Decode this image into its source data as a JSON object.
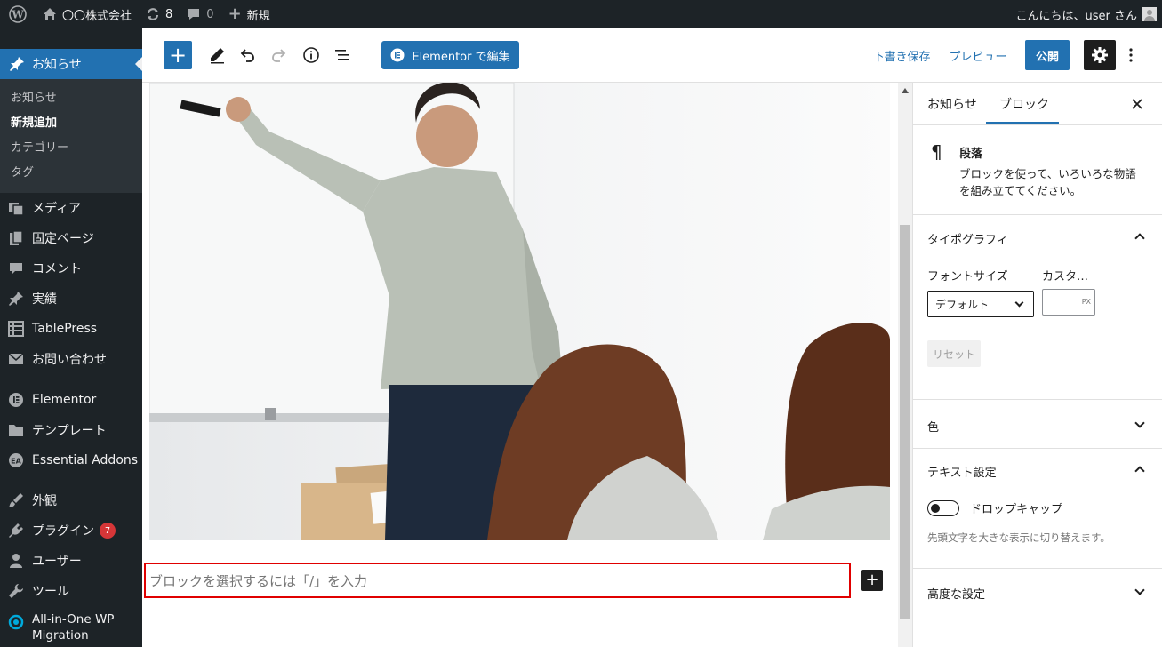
{
  "adminbar": {
    "site_name": "〇〇株式会社",
    "updates_count": "8",
    "comments_count": "0",
    "new_label": "新規",
    "greeting": "こんにちは、user さん"
  },
  "sidebar": {
    "current": "お知らせ",
    "submenu": [
      "お知らせ",
      "新規追加",
      "カテゴリー",
      "タグ"
    ],
    "items": [
      {
        "label": "メディア",
        "icon": "media-icon"
      },
      {
        "label": "固定ページ",
        "icon": "page-icon"
      },
      {
        "label": "コメント",
        "icon": "comment-icon"
      },
      {
        "label": "実績",
        "icon": "pin-icon"
      },
      {
        "label": "TablePress",
        "icon": "table-icon"
      },
      {
        "label": "お問い合わせ",
        "icon": "mail-icon"
      },
      {
        "label": "Elementor",
        "icon": "elementor-icon"
      },
      {
        "label": "テンプレート",
        "icon": "folder-icon"
      },
      {
        "label": "Essential Addons",
        "icon": "ea-icon"
      },
      {
        "label": "外観",
        "icon": "brush-icon"
      },
      {
        "label": "プラグイン",
        "icon": "plugin-icon",
        "badge": "7"
      },
      {
        "label": "ユーザー",
        "icon": "user-icon"
      },
      {
        "label": "ツール",
        "icon": "wrench-icon"
      },
      {
        "label": "All-in-One WP",
        "label2": "Migration",
        "icon": "migration-icon"
      }
    ]
  },
  "header": {
    "elementor_button": "Elementor で編集",
    "save_draft": "下書き保存",
    "preview": "プレビュー",
    "publish": "公開"
  },
  "canvas": {
    "placeholder": "ブロックを選択するには「/」を入力"
  },
  "panel": {
    "tab_post": "お知らせ",
    "tab_block": "ブロック",
    "block_name": "段落",
    "block_desc_1": "ブロックを使って、いろいろな物語",
    "block_desc_2": "を組み立ててください。",
    "typography": "タイポグラフィ",
    "font_size_label": "フォントサイズ",
    "custom_label": "カスタ…",
    "font_size_value": "デフォルト",
    "unit": "PX",
    "reset": "リセット",
    "color": "色",
    "text_settings": "テキスト設定",
    "drop_cap": "ドロップキャップ",
    "drop_cap_help": "先頭文字を大きな表示に切り替えます。",
    "advanced": "高度な設定"
  },
  "colors": {
    "wp_blue": "#2271b1",
    "admin_dark": "#1d2327",
    "publish_blue": "#007cba",
    "highlight_red": "#e00000"
  }
}
